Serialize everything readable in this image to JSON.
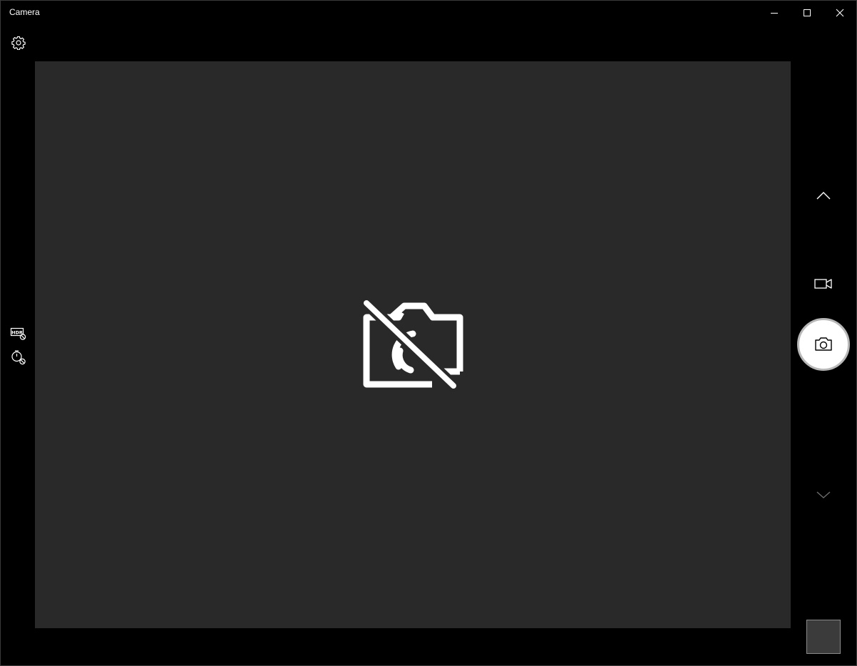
{
  "window": {
    "title": "Camera"
  },
  "icons": {
    "settings": "gear-icon",
    "minimize": "minimize-icon",
    "maximize": "maximize-icon",
    "close": "close-icon",
    "camera_unavailable": "camera-off-icon",
    "hdr": "hdr-off-icon",
    "timer": "timer-off-icon",
    "scroll_up": "chevron-up-icon",
    "scroll_down": "chevron-down-icon",
    "video_mode": "video-camera-icon",
    "photo_capture": "camera-icon"
  },
  "colors": {
    "background": "#000000",
    "viewfinder": "#292929",
    "icon": "#ffffff",
    "shutter_fill": "#ffffff",
    "thumbnail": "#3b3b3b"
  }
}
